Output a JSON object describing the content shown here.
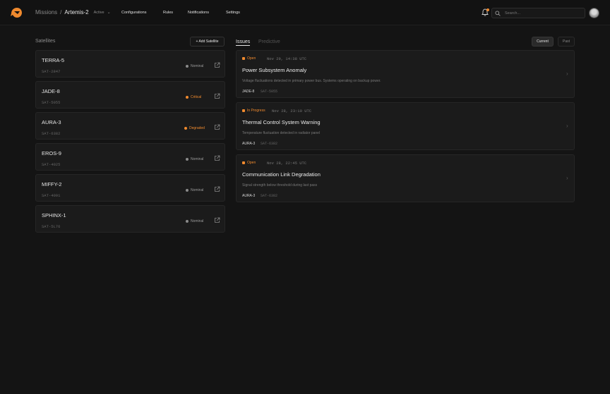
{
  "breadcrumb": {
    "root": "Missions",
    "separator": "/",
    "current": "Artemis-2",
    "status": "Active"
  },
  "nav": [
    {
      "label": "Configurations"
    },
    {
      "label": "Rules"
    },
    {
      "label": "Notifications"
    },
    {
      "label": "Settings"
    }
  ],
  "search": {
    "placeholder": "Search..."
  },
  "satellites": {
    "title": "Satellites",
    "add_label": "+ Add Satellite",
    "items": [
      {
        "name": "TERRA-5",
        "id": "SAT-2847",
        "status": "Nominal"
      },
      {
        "name": "JADE-8",
        "id": "SAT-5055",
        "status": "Critical"
      },
      {
        "name": "AURA-3",
        "id": "SAT-6382",
        "status": "Degraded"
      },
      {
        "name": "EROS-9",
        "id": "SAT-4025",
        "status": "Nominal"
      },
      {
        "name": "MIFFY-2",
        "id": "SAT-4091",
        "status": "Nominal"
      },
      {
        "name": "SPHINX-1",
        "id": "SAT-5L76",
        "status": "Nominal"
      }
    ]
  },
  "issues": {
    "tabs": [
      {
        "label": "Issues"
      },
      {
        "label": "Predictive"
      }
    ],
    "toggle": [
      {
        "label": "Current"
      },
      {
        "label": "Past"
      }
    ],
    "items": [
      {
        "status": "Open",
        "time": "Nov 29, 14:38 UTC",
        "title": "Power Subsystem Anomaly",
        "description": "Voltage fluctuations detected in primary power bus. Systems operating on backup power.",
        "sat_name": "JADE-8",
        "sat_id": "SAT-5055"
      },
      {
        "status": "In Progress",
        "time": "Nov 28, 23:10 UTC",
        "title": "Thermal Control System Warning",
        "description": "Temperature fluctuation detected in radiator panel",
        "sat_name": "AURA-3",
        "sat_id": "SAT-6382"
      },
      {
        "status": "Open",
        "time": "Nov 28, 22:45 UTC",
        "title": "Communication Link Degradation",
        "description": "Signal strength below threshold during last pass",
        "sat_name": "AURA-3",
        "sat_id": "SAT-6382"
      }
    ]
  },
  "colors": {
    "accent": "#f08a2e",
    "background": "#141414",
    "card": "#1b1b1b"
  }
}
